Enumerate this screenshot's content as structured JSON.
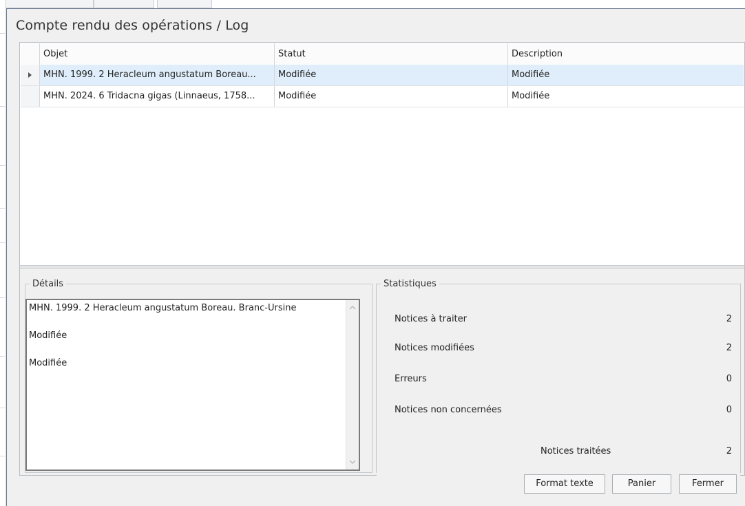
{
  "dialog": {
    "title": "Compte rendu des opérations / Log"
  },
  "grid": {
    "columns": [
      "Objet",
      "Statut",
      "Description"
    ],
    "rows": [
      {
        "objet": "MHN. 1999. 2 Heracleum angustatum Boreau...",
        "statut": "Modifiée",
        "description": "Modifiée"
      },
      {
        "objet": "MHN. 2024. 6 Tridacna gigas (Linnaeus, 1758...",
        "statut": "Modifiée",
        "description": "Modifiée"
      }
    ]
  },
  "details": {
    "legend": "Détails",
    "lines": [
      "MHN. 1999. 2 Heracleum angustatum Boreau. Branc-Ursine",
      "Modifiée",
      "Modifiée"
    ]
  },
  "stats": {
    "legend": "Statistiques",
    "items": [
      {
        "label": "Notices à traiter",
        "value": "2"
      },
      {
        "label": "Notices modifiées",
        "value": "2"
      },
      {
        "label": "Erreurs",
        "value": "0"
      },
      {
        "label": "Notices non concernées",
        "value": "0"
      },
      {
        "label": "Notices traitées",
        "value": "2"
      }
    ]
  },
  "buttons": {
    "format": "Format texte",
    "panier": "Panier",
    "fermer": "Fermer"
  }
}
